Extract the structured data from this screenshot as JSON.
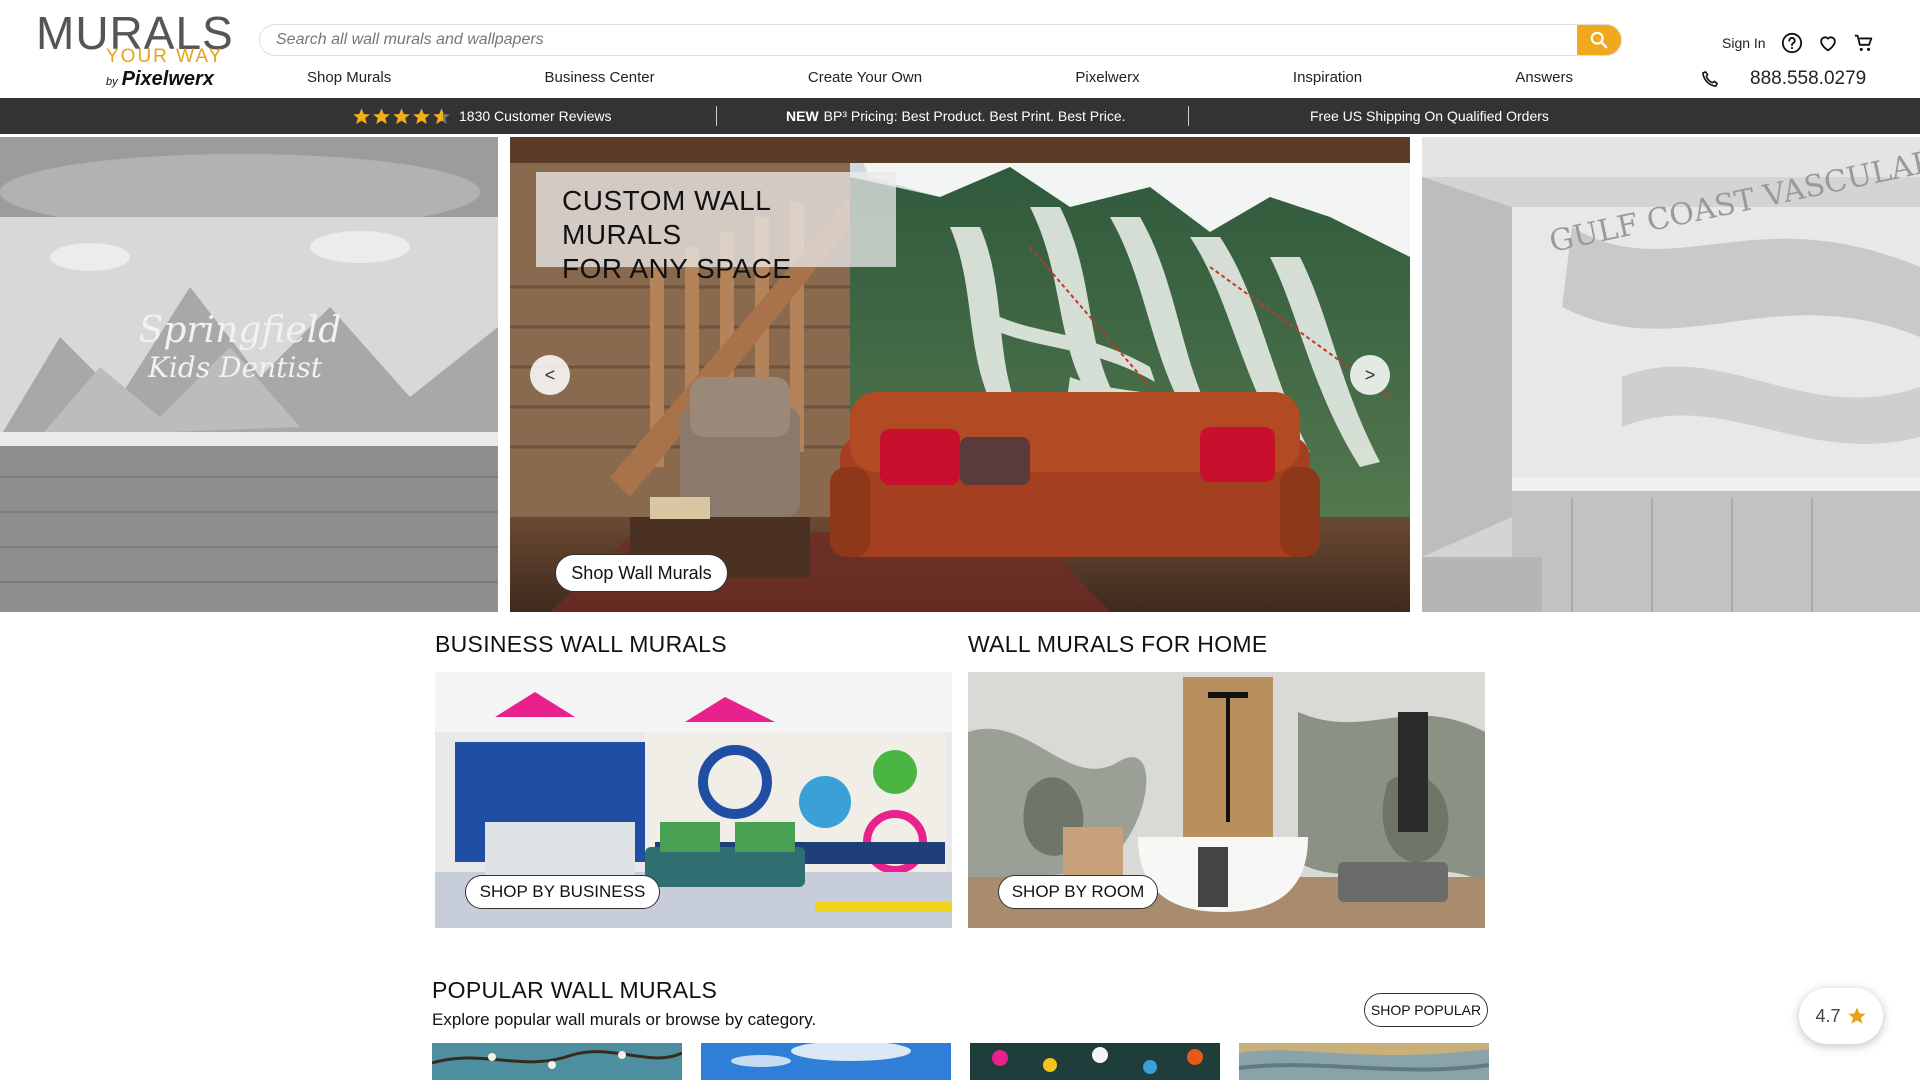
{
  "brand": {
    "line1": "MURALS",
    "line2": "YOUR WAY",
    "by": "by",
    "line3": "Pixelwerx"
  },
  "search": {
    "placeholder": "Search all wall murals and wallpapers",
    "icon": "search-icon"
  },
  "account": {
    "signin": "Sign In",
    "icons": [
      "help-icon",
      "heart-icon",
      "cart-icon"
    ]
  },
  "nav": {
    "items": [
      "Shop Murals",
      "Business Center",
      "Create Your Own",
      "Pixelwerx",
      "Inspiration",
      "Answers"
    ]
  },
  "phone": {
    "icon": "phone-icon",
    "number": "888.558.0279"
  },
  "promo": {
    "reviews": "1830 Customer Reviews",
    "review_stars": 4.5,
    "new_label": "NEW",
    "pricing": "BP³ Pricing: Best Product. Best Print. Best Price.",
    "shipping": "Free US Shipping On Qualified Orders"
  },
  "hero": {
    "title_line1": "CUSTOM WALL MURALS",
    "title_line2": "FOR ANY SPACE",
    "cta": "Shop Wall Murals",
    "prev": "<",
    "next": ">",
    "left_slide_text": "Springfield Kids Dentist",
    "right_slide_text": "GULF COAST VASCULAR"
  },
  "categories": {
    "business": {
      "title": "BUSINESS WALL MURALS",
      "cta": "SHOP BY BUSINESS"
    },
    "home": {
      "title": "WALL MURALS FOR HOME",
      "cta": "SHOP BY ROOM"
    }
  },
  "popular": {
    "title": "POPULAR WALL MURALS",
    "subtitle": "Explore popular wall murals or browse by category.",
    "cta": "SHOP POPULAR"
  },
  "rating_widget": {
    "value": "4.7"
  },
  "colors": {
    "accent": "#f0a81c",
    "promo_bar": "#333333",
    "star": "#f2b01e"
  }
}
